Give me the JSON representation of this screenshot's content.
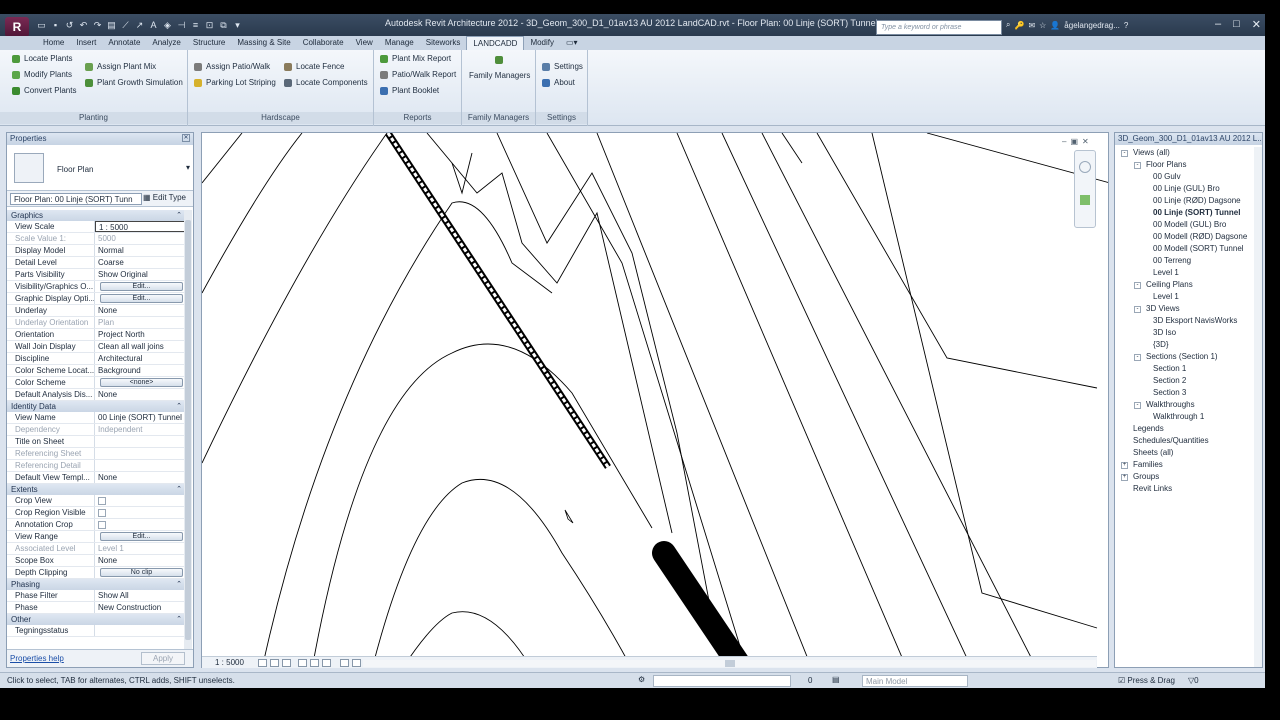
{
  "app": {
    "title": "Autodesk Revit Architecture 2012 - 3D_Geom_300_D1_01av13 AU 2012 LandCAD.rvt - Floor Plan: 00 Linje (SORT) Tunnel",
    "search_placeholder": "Type a keyword or phrase",
    "user": "ågelangedrag..."
  },
  "tabs": [
    "Home",
    "Insert",
    "Annotate",
    "Analyze",
    "Structure",
    "Massing & Site",
    "Collaborate",
    "View",
    "Manage",
    "Siteworks",
    "LANDCADD",
    "Modify"
  ],
  "active_tab": "LANDCADD",
  "ribbon": {
    "planting": {
      "title": "Planting",
      "items": [
        "Locate Plants",
        "Modify Plants",
        "Convert Plants",
        "Assign Plant Mix",
        "Plant Growth Simulation"
      ]
    },
    "hardscape": {
      "title": "Hardscape",
      "items": [
        "Assign Patio/Walk",
        "Parking Lot Striping",
        "Locate Fence",
        "Locate Components"
      ]
    },
    "reports": {
      "title": "Reports",
      "items": [
        "Plant Mix Report",
        "Patio/Walk Report",
        "Plant Booklet"
      ]
    },
    "family_managers": {
      "title": "Family Managers",
      "label": "Family Managers"
    },
    "settings": {
      "title": "Settings",
      "items": [
        "Settings",
        "About"
      ]
    }
  },
  "properties": {
    "title": "Properties",
    "type_name": "Floor Plan",
    "instance": "Floor Plan: 00 Linje (SORT) Tunn",
    "edit_type": "Edit Type",
    "help": "Properties help",
    "apply": "Apply",
    "categories": [
      {
        "name": "Graphics",
        "rows": [
          {
            "k": "View Scale",
            "v": "1 : 5000",
            "kind": "input"
          },
          {
            "k": "Scale Value    1:",
            "v": "5000",
            "kind": "dim"
          },
          {
            "k": "Display Model",
            "v": "Normal"
          },
          {
            "k": "Detail Level",
            "v": "Coarse"
          },
          {
            "k": "Parts Visibility",
            "v": "Show Original"
          },
          {
            "k": "Visibility/Graphics O...",
            "v": "Edit...",
            "kind": "btn"
          },
          {
            "k": "Graphic Display Opti...",
            "v": "Edit...",
            "kind": "btn"
          },
          {
            "k": "Underlay",
            "v": "None"
          },
          {
            "k": "Underlay Orientation",
            "v": "Plan",
            "kind": "dim"
          },
          {
            "k": "Orientation",
            "v": "Project North"
          },
          {
            "k": "Wall Join Display",
            "v": "Clean all wall joins"
          },
          {
            "k": "Discipline",
            "v": "Architectural"
          },
          {
            "k": "Color Scheme Locat...",
            "v": "Background"
          },
          {
            "k": "Color Scheme",
            "v": "<none>",
            "kind": "btn"
          },
          {
            "k": "Default Analysis Dis...",
            "v": "None"
          }
        ]
      },
      {
        "name": "Identity Data",
        "rows": [
          {
            "k": "View Name",
            "v": "00 Linje (SORT) Tunnel"
          },
          {
            "k": "Dependency",
            "v": "Independent",
            "kind": "dim"
          },
          {
            "k": "Title on Sheet",
            "v": ""
          },
          {
            "k": "Referencing Sheet",
            "v": "",
            "kind": "dim"
          },
          {
            "k": "Referencing Detail",
            "v": "",
            "kind": "dim"
          },
          {
            "k": "Default View Templ...",
            "v": "None"
          }
        ]
      },
      {
        "name": "Extents",
        "rows": [
          {
            "k": "Crop View",
            "v": "",
            "kind": "check"
          },
          {
            "k": "Crop Region Visible",
            "v": "",
            "kind": "check"
          },
          {
            "k": "Annotation Crop",
            "v": "",
            "kind": "check"
          },
          {
            "k": "View Range",
            "v": "Edit...",
            "kind": "btn"
          },
          {
            "k": "Associated Level",
            "v": "Level 1",
            "kind": "dim"
          },
          {
            "k": "Scope Box",
            "v": "None"
          },
          {
            "k": "Depth Clipping",
            "v": "No clip",
            "kind": "btn"
          }
        ]
      },
      {
        "name": "Phasing",
        "rows": [
          {
            "k": "Phase Filter",
            "v": "Show All"
          },
          {
            "k": "Phase",
            "v": "New Construction"
          }
        ]
      },
      {
        "name": "Other",
        "rows": [
          {
            "k": "Tegningsstatus",
            "v": ""
          }
        ]
      }
    ]
  },
  "view_bar": {
    "scale": "1 : 5000"
  },
  "browser": {
    "title": "3D_Geom_300_D1_01av13 AU 2012 L...",
    "nodes": [
      {
        "label": "Views (all)",
        "level": 0,
        "exp": "-"
      },
      {
        "label": "Floor Plans",
        "level": 1,
        "exp": "-"
      },
      {
        "label": "00 Gulv",
        "level": 2
      },
      {
        "label": "00 Linje (GUL) Bro",
        "level": 2
      },
      {
        "label": "00 Linje (RØD) Dagsone",
        "level": 2
      },
      {
        "label": "00 Linje (SORT) Tunnel",
        "level": 2,
        "selected": true
      },
      {
        "label": "00 Modell (GUL) Bro",
        "level": 2
      },
      {
        "label": "00 Modell (RØD) Dagsone",
        "level": 2
      },
      {
        "label": "00 Modell (SORT) Tunnel",
        "level": 2
      },
      {
        "label": "00 Terreng",
        "level": 2
      },
      {
        "label": "Level 1",
        "level": 2
      },
      {
        "label": "Ceiling Plans",
        "level": 1,
        "exp": "-"
      },
      {
        "label": "Level 1",
        "level": 2
      },
      {
        "label": "3D Views",
        "level": 1,
        "exp": "-"
      },
      {
        "label": "3D Eksport NavisWorks",
        "level": 2
      },
      {
        "label": "3D Iso",
        "level": 2
      },
      {
        "label": "{3D}",
        "level": 2
      },
      {
        "label": "Sections (Section 1)",
        "level": 1,
        "exp": "-"
      },
      {
        "label": "Section 1",
        "level": 2
      },
      {
        "label": "Section 2",
        "level": 2
      },
      {
        "label": "Section 3",
        "level": 2
      },
      {
        "label": "Walkthroughs",
        "level": 1,
        "exp": "-"
      },
      {
        "label": "Walkthrough 1",
        "level": 2
      },
      {
        "label": "Legends",
        "level": 0
      },
      {
        "label": "Schedules/Quantities",
        "level": 0
      },
      {
        "label": "Sheets (all)",
        "level": 0
      },
      {
        "label": "Families",
        "level": 0,
        "exp": "+"
      },
      {
        "label": "Groups",
        "level": 0,
        "exp": "+"
      },
      {
        "label": "Revit Links",
        "level": 0
      }
    ]
  },
  "status": {
    "message": "Click to select, TAB for alternates, CTRL adds, SHIFT unselects.",
    "zero": "0",
    "model": "Main Model",
    "press_drag": "Press & Drag",
    "filter_count": "0"
  }
}
